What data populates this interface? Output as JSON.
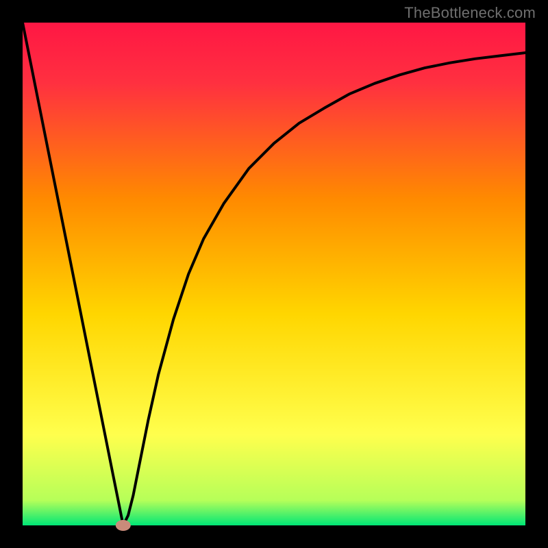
{
  "watermark": "TheBottleneck.com",
  "chart_data": {
    "type": "line",
    "x": [
      0.0,
      0.03,
      0.06,
      0.09,
      0.12,
      0.15,
      0.18,
      0.19,
      0.2,
      0.21,
      0.22,
      0.23,
      0.25,
      0.27,
      0.3,
      0.33,
      0.36,
      0.4,
      0.45,
      0.5,
      0.55,
      0.6,
      0.65,
      0.7,
      0.75,
      0.8,
      0.85,
      0.9,
      0.95,
      1.0
    ],
    "y": [
      1.0,
      0.85,
      0.7,
      0.55,
      0.4,
      0.25,
      0.1,
      0.05,
      0.0,
      0.02,
      0.06,
      0.11,
      0.21,
      0.3,
      0.41,
      0.5,
      0.57,
      0.64,
      0.71,
      0.76,
      0.8,
      0.83,
      0.858,
      0.879,
      0.896,
      0.91,
      0.92,
      0.928,
      0.934,
      0.94
    ],
    "title": "",
    "xlabel": "",
    "ylabel": "",
    "xlim": [
      0,
      1
    ],
    "ylim": [
      0,
      1
    ],
    "minimum_point": {
      "x": 0.2,
      "y": 0.0
    },
    "background_gradient": {
      "top": "#ff1744",
      "mid_upper": "#ff8a00",
      "mid": "#ffd600",
      "mid_lower": "#ffff4d",
      "bottom": "#00e676"
    },
    "marker_color": "#c98b7a",
    "curve_color": "#000000"
  }
}
